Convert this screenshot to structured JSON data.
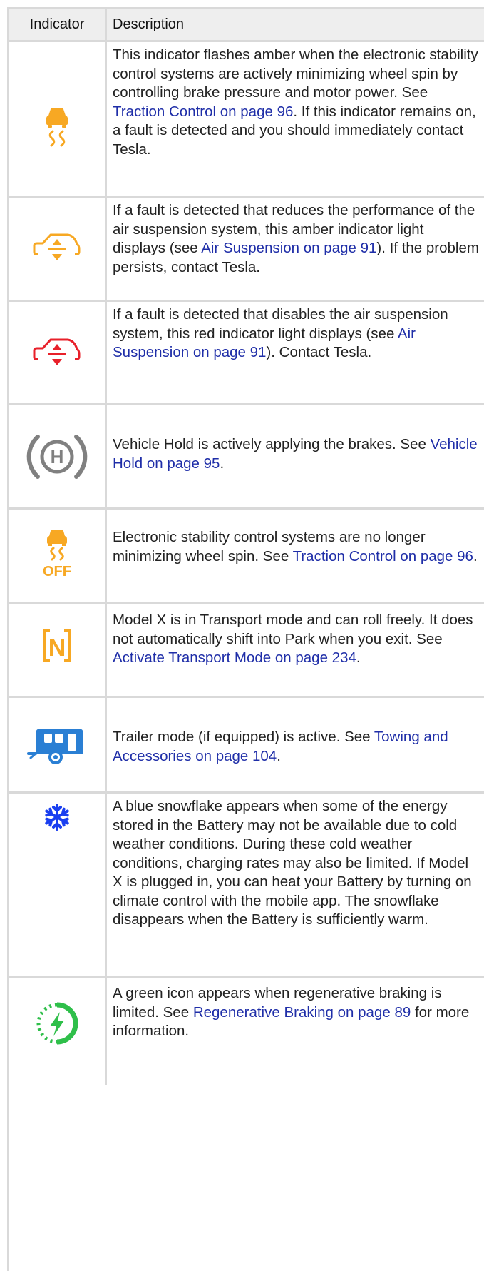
{
  "header": {
    "indicator": "Indicator",
    "description": "Description"
  },
  "rows": [
    {
      "icon": "traction-control-icon",
      "color": "#f7a823",
      "text_before": "This indicator flashes amber when the electronic stability control systems are actively minimizing wheel spin by controlling brake pressure and motor power. See ",
      "link": "Traction Control on page 96",
      "text_after": ". If this indicator remains on, a fault is detected and you should immediately contact Tesla."
    },
    {
      "icon": "air-suspension-fault-icon",
      "color": "#f7a823",
      "text_before": "If a fault is detected that reduces the performance of the air suspension system, this amber indicator light displays (see ",
      "link": "Air Suspension on page 91",
      "text_after": "). If the problem persists, contact Tesla."
    },
    {
      "icon": "air-suspension-disabled-icon",
      "color": "#e8202a",
      "text_before": "If a fault is detected that disables the air suspension system, this red indicator light displays (see ",
      "link": "Air Suspension on page 91",
      "text_after": "). Contact Tesla."
    },
    {
      "icon": "vehicle-hold-icon",
      "color": "#808080",
      "icon_letter": "H",
      "text_before": "Vehicle Hold is actively applying the brakes. See ",
      "link": "Vehicle Hold on page 95",
      "text_after": "."
    },
    {
      "icon": "traction-control-off-icon",
      "color": "#f7a823",
      "icon_text": "OFF",
      "text_before": "Electronic stability control systems are no longer minimizing wheel spin. See ",
      "link": "Traction Control on page 96",
      "text_after": "."
    },
    {
      "icon": "transport-mode-icon",
      "color": "#f7a823",
      "icon_letter": "N",
      "text_before": "Model X is in Transport mode and can roll freely. It does not automatically shift into Park when you exit. See ",
      "link": "Activate Transport Mode on page 234",
      "text_after": "."
    },
    {
      "icon": "trailer-icon",
      "color": "#2a7fd4",
      "text_before": "Trailer mode (if equipped) is active. See ",
      "link": "Towing and Accessories on page 104",
      "text_after": "."
    },
    {
      "icon": "snowflake-icon",
      "color": "#1a3ff0",
      "text_before": "A blue snowflake appears when some of the energy stored in the Battery may not be available due to cold weather conditions. During these cold weather conditions, charging rates may also be limited. If Model X is plugged in, you can heat your Battery by turning on climate control with the mobile app. The snowflake disappears when the Battery is sufficiently warm.",
      "link": "",
      "text_after": ""
    },
    {
      "icon": "regen-braking-limited-icon",
      "color": "#2fbf4a",
      "text_before": "A green icon appears when regenerative braking is limited. See ",
      "link": "Regenerative Braking on page 89",
      "text_after": " for more information."
    }
  ]
}
